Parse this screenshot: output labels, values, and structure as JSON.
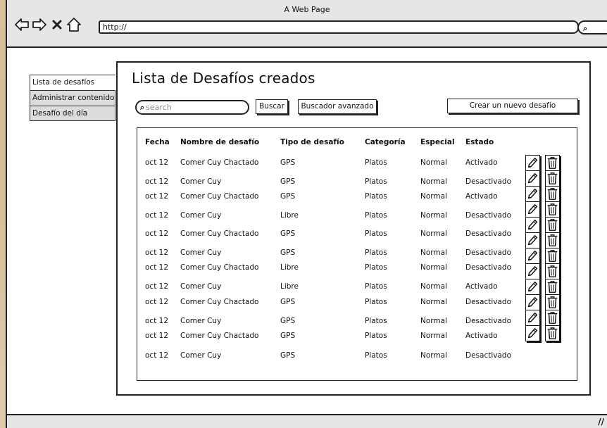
{
  "browser": {
    "title": "A Web Page",
    "url": "http://"
  },
  "sidebar": {
    "items": [
      {
        "label": "Lista de desafíos",
        "active": true
      },
      {
        "label": "Administrar contenidos",
        "active": false
      },
      {
        "label": "Desafío del día",
        "active": false
      }
    ]
  },
  "main": {
    "title": "Lista de Desafíos creados",
    "search_placeholder": "search",
    "buscar_label": "Buscar",
    "avanzado_label": "Buscador avanzado",
    "crear_label": "Crear un nuevo desafío"
  },
  "table": {
    "headers": [
      "Fecha",
      "Nombre de desafío",
      "Tipo de desafío",
      "Categoría",
      "Especial",
      "Estado"
    ],
    "rows": [
      [
        "oct 12",
        "Comer Cuy Chactado",
        "GPS",
        "Platos",
        "Normal",
        "Activado"
      ],
      [
        "oct 12",
        "Comer Cuy",
        "GPS",
        "Platos",
        "Normal",
        "Desactivado"
      ],
      [
        "oct 12",
        "Comer Cuy Chactado",
        "GPS",
        "Platos",
        "Normal",
        "Activado"
      ],
      [
        "oct 12",
        "Comer Cuy",
        "Libre",
        "Platos",
        "Normal",
        "Desactivado"
      ],
      [
        "oct 12",
        "Comer Cuy Chactado",
        "GPS",
        "Platos",
        "Normal",
        "Desactivado"
      ],
      [
        "oct 12",
        "Comer Cuy",
        "GPS",
        "Platos",
        "Normal",
        "Desactivado"
      ],
      [
        "oct 12",
        "Comer Cuy Chactado",
        "Libre",
        "Platos",
        "Normal",
        "Desactivado"
      ],
      [
        "oct 12",
        "Comer Cuy",
        "Libre",
        "Platos",
        "Normal",
        "Activado"
      ],
      [
        "oct 12",
        "Comer Cuy Chactado",
        "GPS",
        "Platos",
        "Normal",
        "Desactivado"
      ],
      [
        "oct 12",
        "Comer Cuy",
        "GPS",
        "Platos",
        "Normal",
        "Desactivado"
      ],
      [
        "oct 12",
        "Comer Cuy Chactado",
        "GPS",
        "Platos",
        "Normal",
        "Activado"
      ],
      [
        "oct 12",
        "Comer Cuy",
        "GPS",
        "Platos",
        "Normal",
        "Desactivado"
      ]
    ],
    "actions": [
      "edit-icon",
      "trash-icon"
    ]
  }
}
